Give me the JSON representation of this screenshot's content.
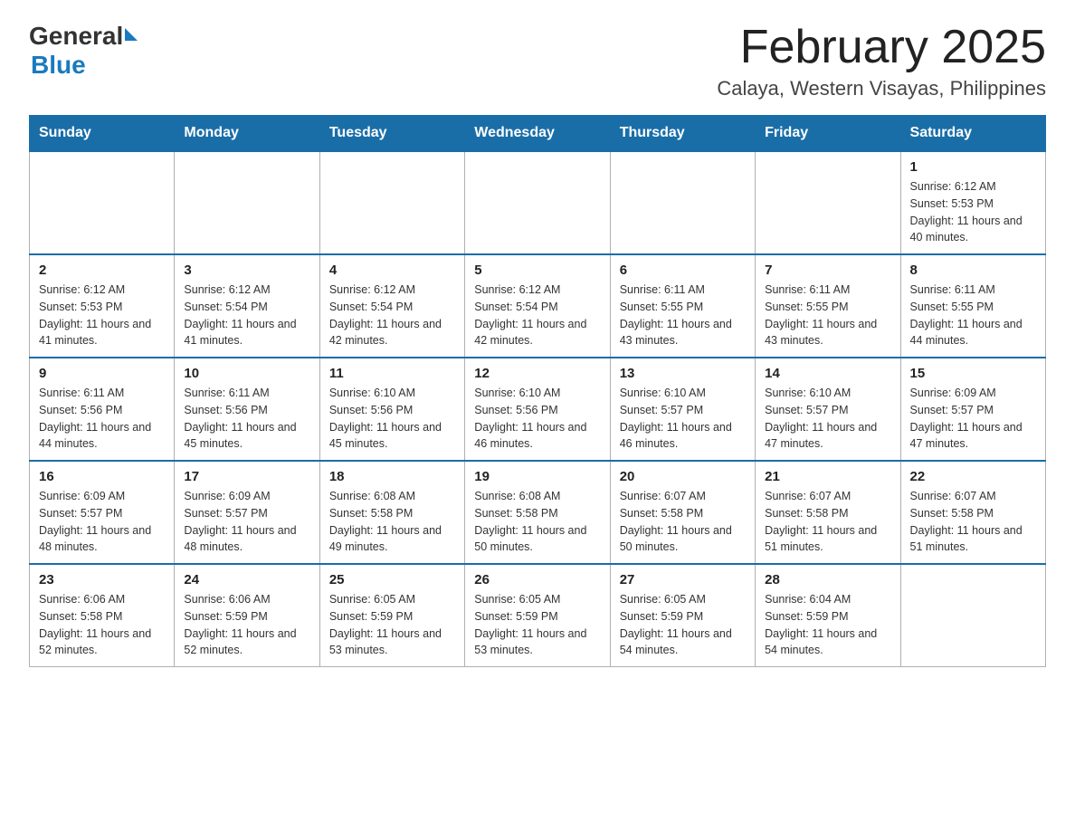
{
  "header": {
    "logo_general": "General",
    "logo_blue": "Blue",
    "month_title": "February 2025",
    "location": "Calaya, Western Visayas, Philippines"
  },
  "weekdays": [
    "Sunday",
    "Monday",
    "Tuesday",
    "Wednesday",
    "Thursday",
    "Friday",
    "Saturday"
  ],
  "weeks": [
    [
      {
        "day": "",
        "sunrise": "",
        "sunset": "",
        "daylight": ""
      },
      {
        "day": "",
        "sunrise": "",
        "sunset": "",
        "daylight": ""
      },
      {
        "day": "",
        "sunrise": "",
        "sunset": "",
        "daylight": ""
      },
      {
        "day": "",
        "sunrise": "",
        "sunset": "",
        "daylight": ""
      },
      {
        "day": "",
        "sunrise": "",
        "sunset": "",
        "daylight": ""
      },
      {
        "day": "",
        "sunrise": "",
        "sunset": "",
        "daylight": ""
      },
      {
        "day": "1",
        "sunrise": "Sunrise: 6:12 AM",
        "sunset": "Sunset: 5:53 PM",
        "daylight": "Daylight: 11 hours and 40 minutes."
      }
    ],
    [
      {
        "day": "2",
        "sunrise": "Sunrise: 6:12 AM",
        "sunset": "Sunset: 5:53 PM",
        "daylight": "Daylight: 11 hours and 41 minutes."
      },
      {
        "day": "3",
        "sunrise": "Sunrise: 6:12 AM",
        "sunset": "Sunset: 5:54 PM",
        "daylight": "Daylight: 11 hours and 41 minutes."
      },
      {
        "day": "4",
        "sunrise": "Sunrise: 6:12 AM",
        "sunset": "Sunset: 5:54 PM",
        "daylight": "Daylight: 11 hours and 42 minutes."
      },
      {
        "day": "5",
        "sunrise": "Sunrise: 6:12 AM",
        "sunset": "Sunset: 5:54 PM",
        "daylight": "Daylight: 11 hours and 42 minutes."
      },
      {
        "day": "6",
        "sunrise": "Sunrise: 6:11 AM",
        "sunset": "Sunset: 5:55 PM",
        "daylight": "Daylight: 11 hours and 43 minutes."
      },
      {
        "day": "7",
        "sunrise": "Sunrise: 6:11 AM",
        "sunset": "Sunset: 5:55 PM",
        "daylight": "Daylight: 11 hours and 43 minutes."
      },
      {
        "day": "8",
        "sunrise": "Sunrise: 6:11 AM",
        "sunset": "Sunset: 5:55 PM",
        "daylight": "Daylight: 11 hours and 44 minutes."
      }
    ],
    [
      {
        "day": "9",
        "sunrise": "Sunrise: 6:11 AM",
        "sunset": "Sunset: 5:56 PM",
        "daylight": "Daylight: 11 hours and 44 minutes."
      },
      {
        "day": "10",
        "sunrise": "Sunrise: 6:11 AM",
        "sunset": "Sunset: 5:56 PM",
        "daylight": "Daylight: 11 hours and 45 minutes."
      },
      {
        "day": "11",
        "sunrise": "Sunrise: 6:10 AM",
        "sunset": "Sunset: 5:56 PM",
        "daylight": "Daylight: 11 hours and 45 minutes."
      },
      {
        "day": "12",
        "sunrise": "Sunrise: 6:10 AM",
        "sunset": "Sunset: 5:56 PM",
        "daylight": "Daylight: 11 hours and 46 minutes."
      },
      {
        "day": "13",
        "sunrise": "Sunrise: 6:10 AM",
        "sunset": "Sunset: 5:57 PM",
        "daylight": "Daylight: 11 hours and 46 minutes."
      },
      {
        "day": "14",
        "sunrise": "Sunrise: 6:10 AM",
        "sunset": "Sunset: 5:57 PM",
        "daylight": "Daylight: 11 hours and 47 minutes."
      },
      {
        "day": "15",
        "sunrise": "Sunrise: 6:09 AM",
        "sunset": "Sunset: 5:57 PM",
        "daylight": "Daylight: 11 hours and 47 minutes."
      }
    ],
    [
      {
        "day": "16",
        "sunrise": "Sunrise: 6:09 AM",
        "sunset": "Sunset: 5:57 PM",
        "daylight": "Daylight: 11 hours and 48 minutes."
      },
      {
        "day": "17",
        "sunrise": "Sunrise: 6:09 AM",
        "sunset": "Sunset: 5:57 PM",
        "daylight": "Daylight: 11 hours and 48 minutes."
      },
      {
        "day": "18",
        "sunrise": "Sunrise: 6:08 AM",
        "sunset": "Sunset: 5:58 PM",
        "daylight": "Daylight: 11 hours and 49 minutes."
      },
      {
        "day": "19",
        "sunrise": "Sunrise: 6:08 AM",
        "sunset": "Sunset: 5:58 PM",
        "daylight": "Daylight: 11 hours and 50 minutes."
      },
      {
        "day": "20",
        "sunrise": "Sunrise: 6:07 AM",
        "sunset": "Sunset: 5:58 PM",
        "daylight": "Daylight: 11 hours and 50 minutes."
      },
      {
        "day": "21",
        "sunrise": "Sunrise: 6:07 AM",
        "sunset": "Sunset: 5:58 PM",
        "daylight": "Daylight: 11 hours and 51 minutes."
      },
      {
        "day": "22",
        "sunrise": "Sunrise: 6:07 AM",
        "sunset": "Sunset: 5:58 PM",
        "daylight": "Daylight: 11 hours and 51 minutes."
      }
    ],
    [
      {
        "day": "23",
        "sunrise": "Sunrise: 6:06 AM",
        "sunset": "Sunset: 5:58 PM",
        "daylight": "Daylight: 11 hours and 52 minutes."
      },
      {
        "day": "24",
        "sunrise": "Sunrise: 6:06 AM",
        "sunset": "Sunset: 5:59 PM",
        "daylight": "Daylight: 11 hours and 52 minutes."
      },
      {
        "day": "25",
        "sunrise": "Sunrise: 6:05 AM",
        "sunset": "Sunset: 5:59 PM",
        "daylight": "Daylight: 11 hours and 53 minutes."
      },
      {
        "day": "26",
        "sunrise": "Sunrise: 6:05 AM",
        "sunset": "Sunset: 5:59 PM",
        "daylight": "Daylight: 11 hours and 53 minutes."
      },
      {
        "day": "27",
        "sunrise": "Sunrise: 6:05 AM",
        "sunset": "Sunset: 5:59 PM",
        "daylight": "Daylight: 11 hours and 54 minutes."
      },
      {
        "day": "28",
        "sunrise": "Sunrise: 6:04 AM",
        "sunset": "Sunset: 5:59 PM",
        "daylight": "Daylight: 11 hours and 54 minutes."
      },
      {
        "day": "",
        "sunrise": "",
        "sunset": "",
        "daylight": ""
      }
    ]
  ]
}
